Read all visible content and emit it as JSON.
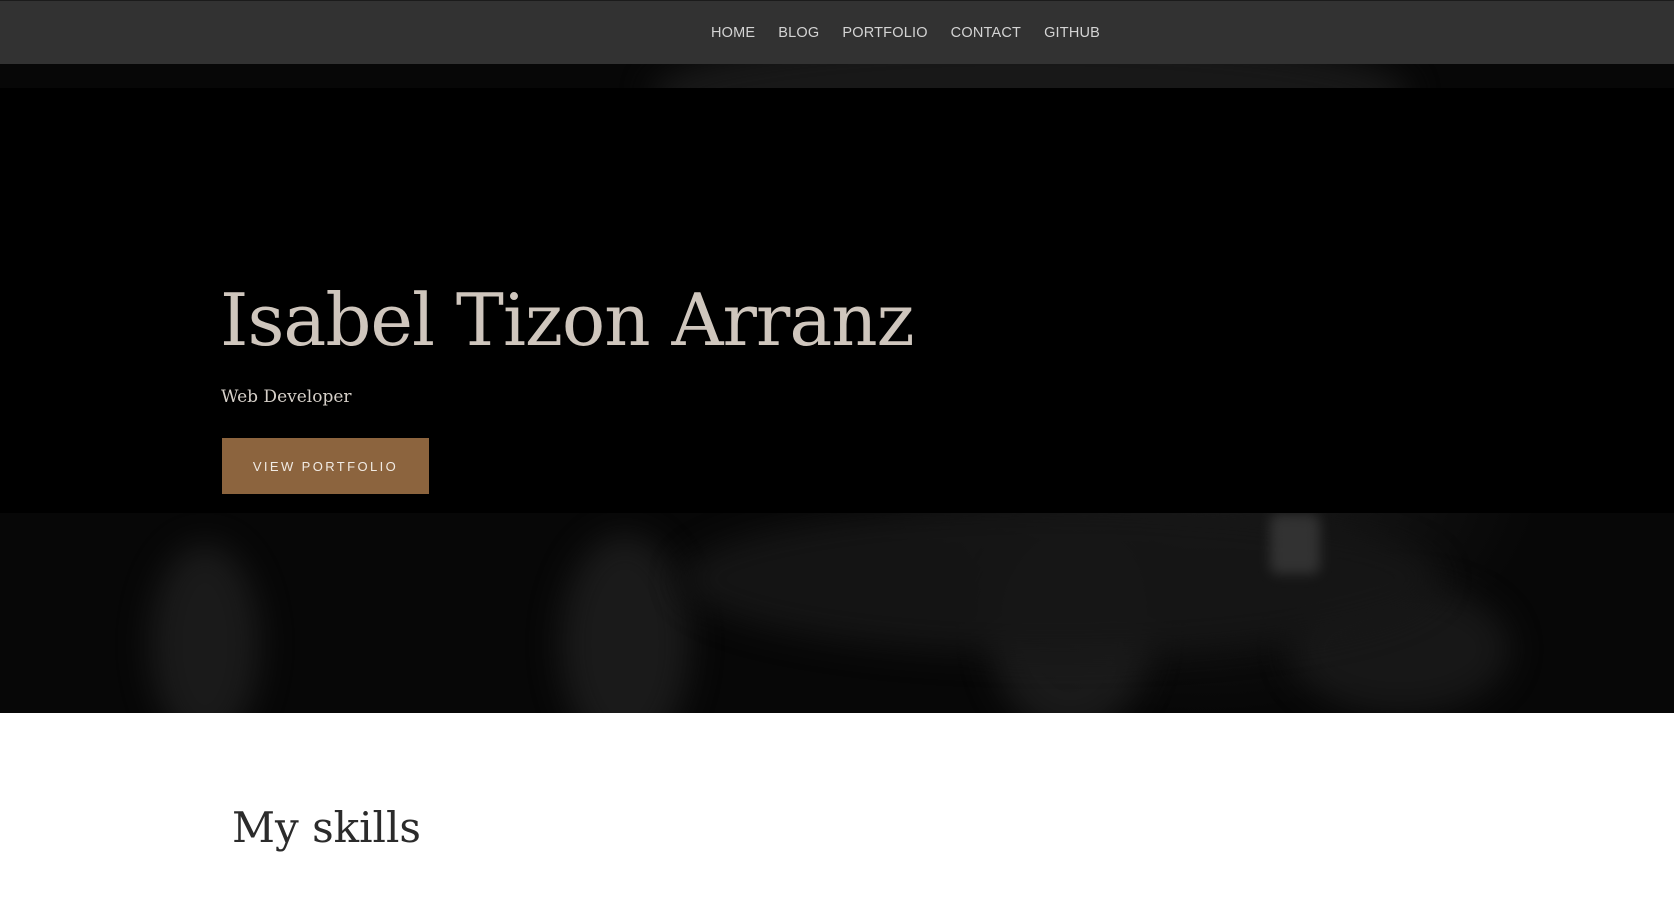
{
  "nav": {
    "items": [
      {
        "label": "HOME"
      },
      {
        "label": "BLOG"
      },
      {
        "label": "PORTFOLIO"
      },
      {
        "label": "CONTACT"
      },
      {
        "label": "GITHUB"
      }
    ]
  },
  "hero": {
    "name": "Isabel Tizon Arranz",
    "role": "Web Developer",
    "cta_label": "VIEW PORTFOLIO"
  },
  "skills": {
    "title": "My skills"
  },
  "colors": {
    "nav_background": "#323232",
    "accent": "#8c643e",
    "hero_text": "#cfc6bd"
  }
}
